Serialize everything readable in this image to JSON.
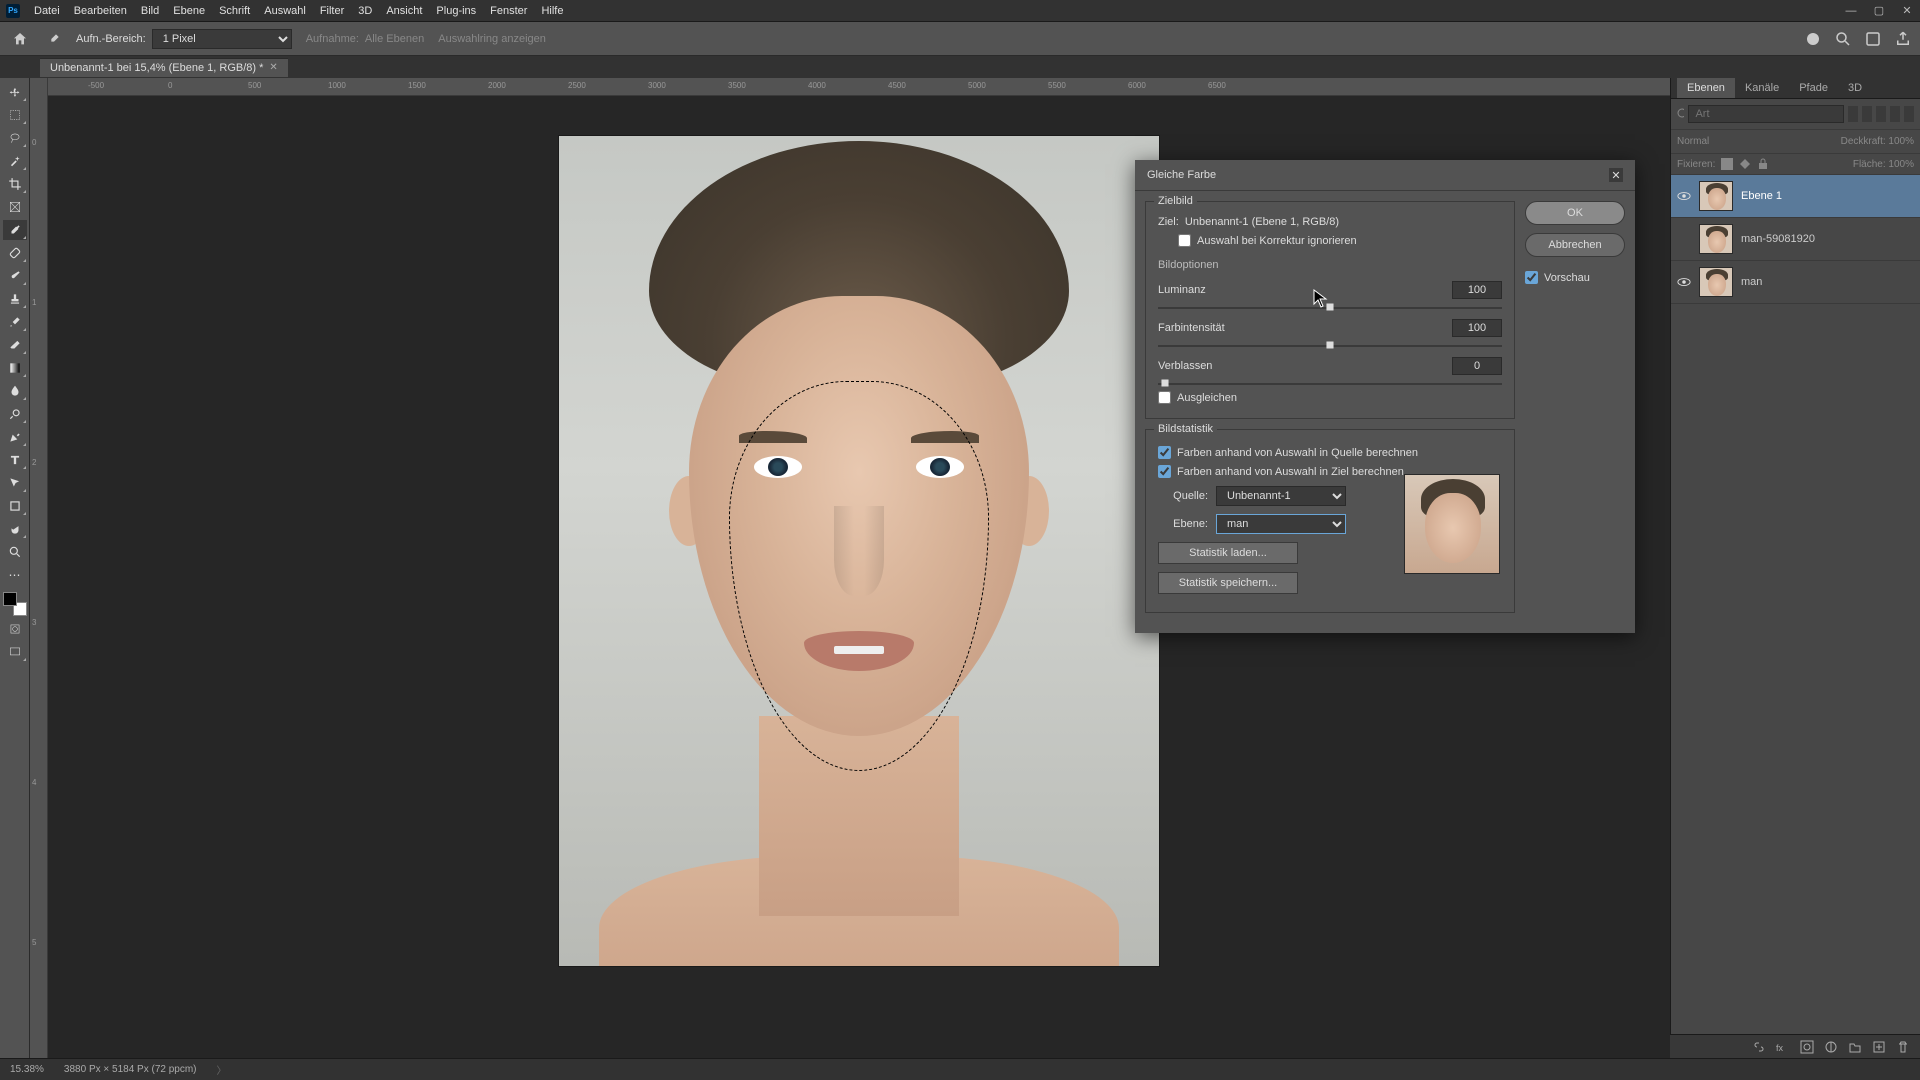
{
  "menu": [
    "Datei",
    "Bearbeiten",
    "Bild",
    "Ebene",
    "Schrift",
    "Auswahl",
    "Filter",
    "3D",
    "Ansicht",
    "Plug-ins",
    "Fenster",
    "Hilfe"
  ],
  "options": {
    "sample_label": "Aufn.-Bereich:",
    "sample_value": "1 Pixel",
    "sample2_label": "Aufnahme:",
    "sample2_value": "Alle Ebenen",
    "show_label": "Auswahlring anzeigen"
  },
  "doc_tab": {
    "title": "Unbenannt-1 bei 15,4% (Ebene 1, RGB/8) *"
  },
  "ruler_h": [
    "0",
    "500",
    "1000",
    "1500",
    "2000",
    "2500",
    "3000",
    "3500",
    "4000",
    "4500",
    "5000",
    "5500",
    "6000",
    "6500"
  ],
  "ruler_v": [
    "0",
    "1",
    "2",
    "3",
    "4",
    "5"
  ],
  "dialog": {
    "title": "Gleiche Farbe",
    "ok": "OK",
    "cancel": "Abbrechen",
    "preview": "Vorschau",
    "section_target": "Zielbild",
    "target_label": "Ziel:",
    "target_value": "Unbenannt-1 (Ebene 1, RGB/8)",
    "ignore_sel": "Auswahl bei Korrektur ignorieren",
    "section_options": "Bildoptionen",
    "luminance_label": "Luminanz",
    "luminance_value": "100",
    "intensity_label": "Farbintensität",
    "intensity_value": "100",
    "fade_label": "Verblassen",
    "fade_value": "0",
    "neutralize": "Ausgleichen",
    "section_stats": "Bildstatistik",
    "stat_chk1": "Farben anhand von Auswahl in Quelle berechnen",
    "stat_chk2": "Farben anhand von Auswahl in Ziel berechnen",
    "source_label": "Quelle:",
    "source_value": "Unbenannt-1",
    "layer_label": "Ebene:",
    "layer_value": "man",
    "load_stats": "Statistik laden...",
    "save_stats": "Statistik speichern..."
  },
  "panels": {
    "tabs": [
      "Ebenen",
      "Kanäle",
      "Pfade",
      "3D"
    ],
    "search_placeholder": "Art",
    "mode": "Normal",
    "opacity_label": "Deckkraft:",
    "opacity_value": "100%",
    "lock_label": "Fixieren:",
    "fill_label": "Fläche:",
    "fill_value": "100%",
    "layers": [
      {
        "name": "Ebene 1",
        "visible": true
      },
      {
        "name": "man-59081920",
        "visible": false
      },
      {
        "name": "man",
        "visible": true
      }
    ]
  },
  "status": {
    "zoom": "15.38%",
    "dims": "3880 Px × 5184 Px (72 ppcm)"
  }
}
